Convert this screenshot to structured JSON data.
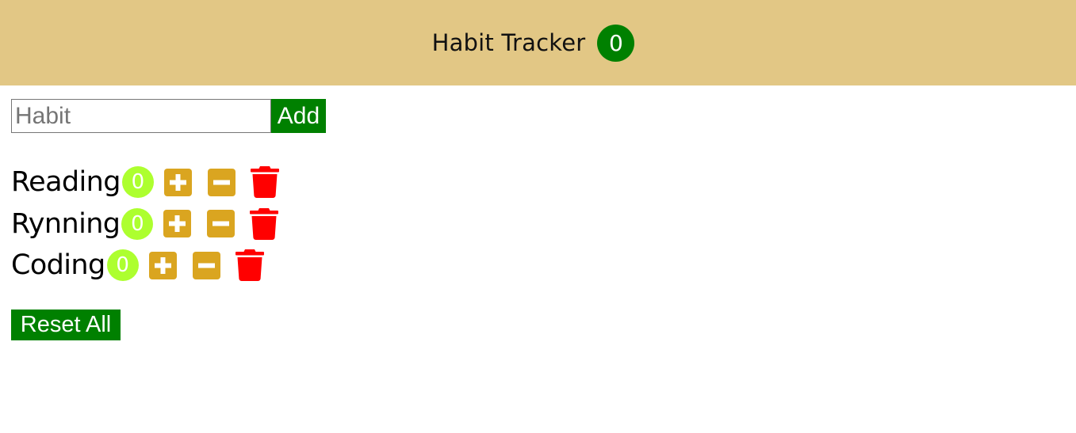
{
  "navbar": {
    "title": "Habit Tracker",
    "total_count": "0"
  },
  "add_form": {
    "placeholder": "Habit",
    "value": "",
    "add_label": "Add"
  },
  "habits": [
    {
      "name": "Reading",
      "count": "0"
    },
    {
      "name": "Rynning",
      "count": "0"
    },
    {
      "name": "Coding",
      "count": "0"
    }
  ],
  "icons": {
    "increment": "plus-square-icon",
    "decrement": "minus-square-icon",
    "delete": "trash-icon"
  },
  "colors": {
    "navbar_bg": "#e2c785",
    "accent_green": "#008000",
    "count_badge": "#adff2f",
    "control_icon": "#daa520",
    "delete_icon": "#ff0000"
  },
  "reset_label": "Reset All"
}
